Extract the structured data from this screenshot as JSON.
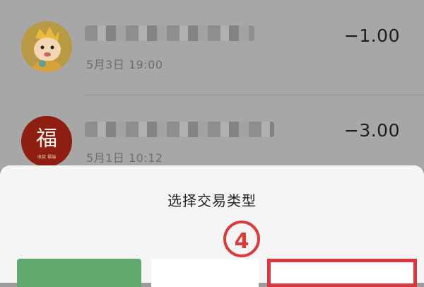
{
  "transactions": [
    {
      "time": "5月3日 19:00",
      "amount": "−1.00",
      "avatar_icon": "cartoon-character-icon"
    },
    {
      "time": "5月1日 10:12",
      "amount": "−3.00",
      "avatar_icon": "fu-red-icon",
      "avatar_text": "福",
      "avatar_caption": "收款 福瑞"
    }
  ],
  "sheet": {
    "title": "选择交易类型",
    "step_marker": "④",
    "options": [
      "",
      "",
      ""
    ]
  },
  "colors": {
    "option_primary": "#5fa96d",
    "highlight": "#d9363e"
  }
}
